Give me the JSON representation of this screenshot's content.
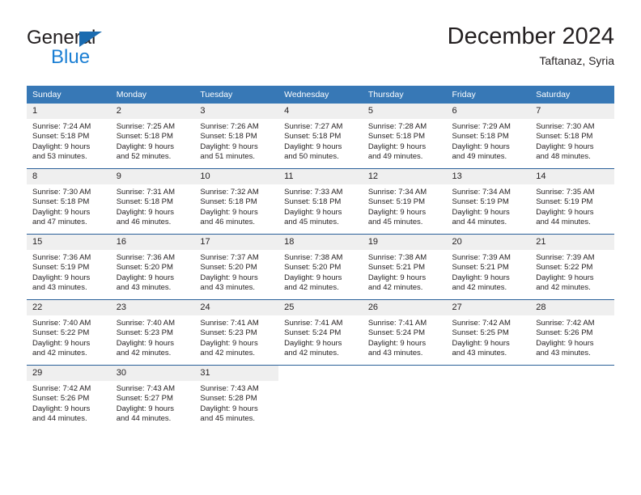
{
  "brand": {
    "name_part1": "General",
    "name_part2": "Blue",
    "triangle_color": "#1a6bb0",
    "blue_color": "#1b7fd4"
  },
  "header": {
    "title": "December 2024",
    "subtitle": "Taftanaz, Syria"
  },
  "theme": {
    "header_bg": "#3778b6",
    "row_divider": "#2a6099",
    "daynum_bg": "#efefef",
    "text": "#231f20"
  },
  "calendar": {
    "weekday_headers": [
      "Sunday",
      "Monday",
      "Tuesday",
      "Wednesday",
      "Thursday",
      "Friday",
      "Saturday"
    ],
    "weeks": [
      [
        {
          "day": "1",
          "sunrise": "Sunrise: 7:24 AM",
          "sunset": "Sunset: 5:18 PM",
          "daylight1": "Daylight: 9 hours",
          "daylight2": "and 53 minutes."
        },
        {
          "day": "2",
          "sunrise": "Sunrise: 7:25 AM",
          "sunset": "Sunset: 5:18 PM",
          "daylight1": "Daylight: 9 hours",
          "daylight2": "and 52 minutes."
        },
        {
          "day": "3",
          "sunrise": "Sunrise: 7:26 AM",
          "sunset": "Sunset: 5:18 PM",
          "daylight1": "Daylight: 9 hours",
          "daylight2": "and 51 minutes."
        },
        {
          "day": "4",
          "sunrise": "Sunrise: 7:27 AM",
          "sunset": "Sunset: 5:18 PM",
          "daylight1": "Daylight: 9 hours",
          "daylight2": "and 50 minutes."
        },
        {
          "day": "5",
          "sunrise": "Sunrise: 7:28 AM",
          "sunset": "Sunset: 5:18 PM",
          "daylight1": "Daylight: 9 hours",
          "daylight2": "and 49 minutes."
        },
        {
          "day": "6",
          "sunrise": "Sunrise: 7:29 AM",
          "sunset": "Sunset: 5:18 PM",
          "daylight1": "Daylight: 9 hours",
          "daylight2": "and 49 minutes."
        },
        {
          "day": "7",
          "sunrise": "Sunrise: 7:30 AM",
          "sunset": "Sunset: 5:18 PM",
          "daylight1": "Daylight: 9 hours",
          "daylight2": "and 48 minutes."
        }
      ],
      [
        {
          "day": "8",
          "sunrise": "Sunrise: 7:30 AM",
          "sunset": "Sunset: 5:18 PM",
          "daylight1": "Daylight: 9 hours",
          "daylight2": "and 47 minutes."
        },
        {
          "day": "9",
          "sunrise": "Sunrise: 7:31 AM",
          "sunset": "Sunset: 5:18 PM",
          "daylight1": "Daylight: 9 hours",
          "daylight2": "and 46 minutes."
        },
        {
          "day": "10",
          "sunrise": "Sunrise: 7:32 AM",
          "sunset": "Sunset: 5:18 PM",
          "daylight1": "Daylight: 9 hours",
          "daylight2": "and 46 minutes."
        },
        {
          "day": "11",
          "sunrise": "Sunrise: 7:33 AM",
          "sunset": "Sunset: 5:18 PM",
          "daylight1": "Daylight: 9 hours",
          "daylight2": "and 45 minutes."
        },
        {
          "day": "12",
          "sunrise": "Sunrise: 7:34 AM",
          "sunset": "Sunset: 5:19 PM",
          "daylight1": "Daylight: 9 hours",
          "daylight2": "and 45 minutes."
        },
        {
          "day": "13",
          "sunrise": "Sunrise: 7:34 AM",
          "sunset": "Sunset: 5:19 PM",
          "daylight1": "Daylight: 9 hours",
          "daylight2": "and 44 minutes."
        },
        {
          "day": "14",
          "sunrise": "Sunrise: 7:35 AM",
          "sunset": "Sunset: 5:19 PM",
          "daylight1": "Daylight: 9 hours",
          "daylight2": "and 44 minutes."
        }
      ],
      [
        {
          "day": "15",
          "sunrise": "Sunrise: 7:36 AM",
          "sunset": "Sunset: 5:19 PM",
          "daylight1": "Daylight: 9 hours",
          "daylight2": "and 43 minutes."
        },
        {
          "day": "16",
          "sunrise": "Sunrise: 7:36 AM",
          "sunset": "Sunset: 5:20 PM",
          "daylight1": "Daylight: 9 hours",
          "daylight2": "and 43 minutes."
        },
        {
          "day": "17",
          "sunrise": "Sunrise: 7:37 AM",
          "sunset": "Sunset: 5:20 PM",
          "daylight1": "Daylight: 9 hours",
          "daylight2": "and 43 minutes."
        },
        {
          "day": "18",
          "sunrise": "Sunrise: 7:38 AM",
          "sunset": "Sunset: 5:20 PM",
          "daylight1": "Daylight: 9 hours",
          "daylight2": "and 42 minutes."
        },
        {
          "day": "19",
          "sunrise": "Sunrise: 7:38 AM",
          "sunset": "Sunset: 5:21 PM",
          "daylight1": "Daylight: 9 hours",
          "daylight2": "and 42 minutes."
        },
        {
          "day": "20",
          "sunrise": "Sunrise: 7:39 AM",
          "sunset": "Sunset: 5:21 PM",
          "daylight1": "Daylight: 9 hours",
          "daylight2": "and 42 minutes."
        },
        {
          "day": "21",
          "sunrise": "Sunrise: 7:39 AM",
          "sunset": "Sunset: 5:22 PM",
          "daylight1": "Daylight: 9 hours",
          "daylight2": "and 42 minutes."
        }
      ],
      [
        {
          "day": "22",
          "sunrise": "Sunrise: 7:40 AM",
          "sunset": "Sunset: 5:22 PM",
          "daylight1": "Daylight: 9 hours",
          "daylight2": "and 42 minutes."
        },
        {
          "day": "23",
          "sunrise": "Sunrise: 7:40 AM",
          "sunset": "Sunset: 5:23 PM",
          "daylight1": "Daylight: 9 hours",
          "daylight2": "and 42 minutes."
        },
        {
          "day": "24",
          "sunrise": "Sunrise: 7:41 AM",
          "sunset": "Sunset: 5:23 PM",
          "daylight1": "Daylight: 9 hours",
          "daylight2": "and 42 minutes."
        },
        {
          "day": "25",
          "sunrise": "Sunrise: 7:41 AM",
          "sunset": "Sunset: 5:24 PM",
          "daylight1": "Daylight: 9 hours",
          "daylight2": "and 42 minutes."
        },
        {
          "day": "26",
          "sunrise": "Sunrise: 7:41 AM",
          "sunset": "Sunset: 5:24 PM",
          "daylight1": "Daylight: 9 hours",
          "daylight2": "and 43 minutes."
        },
        {
          "day": "27",
          "sunrise": "Sunrise: 7:42 AM",
          "sunset": "Sunset: 5:25 PM",
          "daylight1": "Daylight: 9 hours",
          "daylight2": "and 43 minutes."
        },
        {
          "day": "28",
          "sunrise": "Sunrise: 7:42 AM",
          "sunset": "Sunset: 5:26 PM",
          "daylight1": "Daylight: 9 hours",
          "daylight2": "and 43 minutes."
        }
      ],
      [
        {
          "day": "29",
          "sunrise": "Sunrise: 7:42 AM",
          "sunset": "Sunset: 5:26 PM",
          "daylight1": "Daylight: 9 hours",
          "daylight2": "and 44 minutes."
        },
        {
          "day": "30",
          "sunrise": "Sunrise: 7:43 AM",
          "sunset": "Sunset: 5:27 PM",
          "daylight1": "Daylight: 9 hours",
          "daylight2": "and 44 minutes."
        },
        {
          "day": "31",
          "sunrise": "Sunrise: 7:43 AM",
          "sunset": "Sunset: 5:28 PM",
          "daylight1": "Daylight: 9 hours",
          "daylight2": "and 45 minutes."
        },
        {
          "day": "",
          "sunrise": "",
          "sunset": "",
          "daylight1": "",
          "daylight2": ""
        },
        {
          "day": "",
          "sunrise": "",
          "sunset": "",
          "daylight1": "",
          "daylight2": ""
        },
        {
          "day": "",
          "sunrise": "",
          "sunset": "",
          "daylight1": "",
          "daylight2": ""
        },
        {
          "day": "",
          "sunrise": "",
          "sunset": "",
          "daylight1": "",
          "daylight2": ""
        }
      ]
    ]
  }
}
